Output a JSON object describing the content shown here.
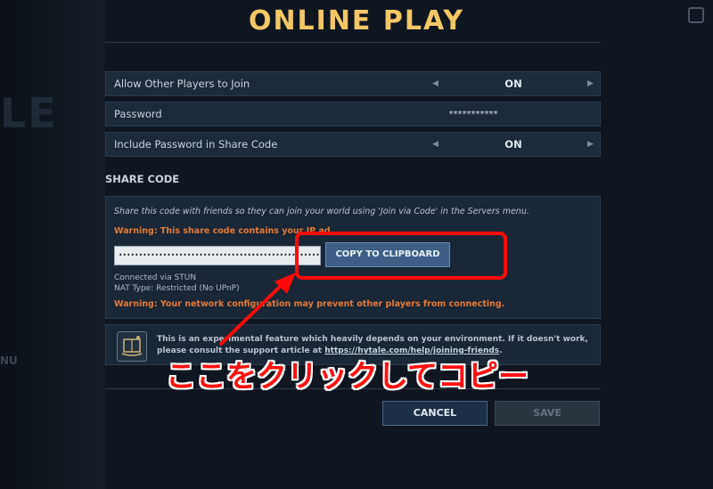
{
  "background": {
    "ghost_text": "LE",
    "ghost_menu_text": "NU"
  },
  "title": "ONLINE PLAY",
  "settings": [
    {
      "label": "Allow Other Players to Join",
      "value": "ON"
    },
    {
      "label": "Password",
      "value": "***********"
    },
    {
      "label": "Include Password in Share Code",
      "value": "ON"
    }
  ],
  "share": {
    "section_title": "SHARE CODE",
    "description": "Share this code with friends so they can join your world using 'Join via Code' in the Servers menu.",
    "warning_ip": "Warning: This share code contains your IP ad",
    "code_value": "•••••••••••••••••••••••••••••••••••••••••••••••••••••••••••••••••",
    "copy_label": "COPY TO CLIPBOARD",
    "connected_via": "Connected via STUN",
    "nat_type": "NAT Type: Restricted (No UPnP)",
    "warning_network_a": "Warning: Your network configuration ma",
    "warning_network_b": "y prevent other players from connecting."
  },
  "info": {
    "text": "This is an experimental feature which heavily depends on your environment. If it doesn't work, please consult the support article at ",
    "link": "https://hytale.com/help/joining-friends",
    "after_link": ".",
    "icon": "book-icon"
  },
  "buttons": {
    "cancel": "CANCEL",
    "save": "SAVE"
  },
  "annotation": {
    "text": "ここをクリックしてコピー",
    "color": "#ff1010"
  },
  "colors": {
    "title": "#f2c866",
    "warning": "#e07a3a",
    "accent": "#3e5e86",
    "annotation": "#ff0a0a"
  }
}
